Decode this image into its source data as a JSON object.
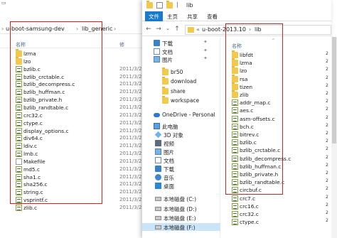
{
  "left_window": {
    "breadcrumb": [
      "u-boot-samsung-dev",
      "lib_generic"
    ],
    "column_name": "名称",
    "column_date": "修",
    "files": [
      {
        "name": "lzma",
        "kind": "folder",
        "date": ""
      },
      {
        "name": "lzo",
        "kind": "folder",
        "date": ""
      },
      {
        "name": "bzlib.c",
        "kind": "c",
        "date": "2011/3/2"
      },
      {
        "name": "bzlib_crctable.c",
        "kind": "c",
        "date": "2011/3/2"
      },
      {
        "name": "bzlib_decompress.c",
        "kind": "c",
        "date": "2011/3/2"
      },
      {
        "name": "bzlib_huffman.c",
        "kind": "c",
        "date": "2011/3/2"
      },
      {
        "name": "bzlib_private.h",
        "kind": "c",
        "date": "2011/3/2"
      },
      {
        "name": "bzlib_randtable.c",
        "kind": "c",
        "date": "2011/3/2"
      },
      {
        "name": "crc32.c",
        "kind": "c",
        "date": "2011/3/2"
      },
      {
        "name": "ctype.c",
        "kind": "c",
        "date": "2011/3/2"
      },
      {
        "name": "display_options.c",
        "kind": "c",
        "date": "2011/3/2"
      },
      {
        "name": "div64.c",
        "kind": "c",
        "date": "2011/3/2"
      },
      {
        "name": "ldiv.c",
        "kind": "c",
        "date": "2011/3/2"
      },
      {
        "name": "lmb.c",
        "kind": "c",
        "date": "2011/3/2"
      },
      {
        "name": "Makefile",
        "kind": "file",
        "date": "2011/3/2"
      },
      {
        "name": "md5.c",
        "kind": "c",
        "date": "2011/3/2"
      },
      {
        "name": "sha1.c",
        "kind": "c",
        "date": "2011/3/2"
      },
      {
        "name": "sha256.c",
        "kind": "c",
        "date": "2011/3/2"
      },
      {
        "name": "string.c",
        "kind": "c",
        "date": "2011/3/2"
      },
      {
        "name": "vsprintf.c",
        "kind": "c",
        "date": "2011/3/2"
      },
      {
        "name": "zlib.c",
        "kind": "c",
        "date": "2011/3/2"
      }
    ]
  },
  "right_window": {
    "title": "lib",
    "ribbon_tabs": [
      "文件",
      "主页",
      "共享",
      "查看"
    ],
    "address": [
      "u-boot-2013.10",
      "lib"
    ],
    "nav_items": [
      {
        "label": "下载",
        "icon": "download-icon",
        "pinned": true
      },
      {
        "label": "文档",
        "icon": "document-icon",
        "pinned": true
      },
      {
        "label": "图片",
        "icon": "picture-icon",
        "pinned": true
      },
      {
        "label": "br50",
        "icon": "folder-icon",
        "pinned": false
      },
      {
        "label": "download",
        "icon": "folder-icon",
        "pinned": false
      },
      {
        "label": "share",
        "icon": "folder-icon",
        "pinned": false
      },
      {
        "label": "workspace",
        "icon": "folder-icon",
        "pinned": false
      },
      {
        "label": "OneDrive - Personal",
        "icon": "onedrive-icon",
        "pinned": false
      },
      {
        "label": "此电脑",
        "icon": "pc-icon",
        "pinned": false
      },
      {
        "label": "3D 对象",
        "icon": "3d-objects-icon",
        "pinned": false
      },
      {
        "label": "视频",
        "icon": "video-icon",
        "pinned": false
      },
      {
        "label": "图片",
        "icon": "picture-icon",
        "pinned": false
      },
      {
        "label": "文档",
        "icon": "document-icon",
        "pinned": false
      },
      {
        "label": "下载",
        "icon": "download-icon",
        "pinned": false
      },
      {
        "label": "音乐",
        "icon": "music-icon",
        "pinned": false
      },
      {
        "label": "桌面",
        "icon": "desktop-icon",
        "pinned": false
      },
      {
        "label": "本地磁盘 (C:)",
        "icon": "drive-icon",
        "pinned": false
      },
      {
        "label": "本地磁盘 (D:)",
        "icon": "drive-icon",
        "pinned": false
      },
      {
        "label": "本地磁盘 (E:)",
        "icon": "drive-icon",
        "pinned": false
      },
      {
        "label": "本地磁盘 (F:)",
        "icon": "drive-icon",
        "pinned": false
      }
    ],
    "column_name": "名称",
    "files": [
      {
        "name": "libfdt",
        "kind": "folder"
      },
      {
        "name": "lzma",
        "kind": "folder"
      },
      {
        "name": "lzo",
        "kind": "folder"
      },
      {
        "name": "rsa",
        "kind": "folder"
      },
      {
        "name": "tizen",
        "kind": "folder"
      },
      {
        "name": "zlib",
        "kind": "folder"
      },
      {
        "name": "addr_map.c",
        "kind": "c"
      },
      {
        "name": "aes.c",
        "kind": "c"
      },
      {
        "name": "asm-offsets.c",
        "kind": "c"
      },
      {
        "name": "bch.c",
        "kind": "c"
      },
      {
        "name": "bitrev.c",
        "kind": "c"
      },
      {
        "name": "bzlib.c",
        "kind": "c"
      },
      {
        "name": "bzlib_crctable.c",
        "kind": "c"
      },
      {
        "name": "bzlib_decompress.c",
        "kind": "c"
      },
      {
        "name": "bzlib_huffman.c",
        "kind": "c"
      },
      {
        "name": "bzlib_private.h",
        "kind": "c"
      },
      {
        "name": "bzlib_randtable.c",
        "kind": "c"
      },
      {
        "name": "circbuf.c",
        "kind": "c"
      },
      {
        "name": "crc7.c",
        "kind": "c"
      },
      {
        "name": "crc16.c",
        "kind": "c"
      },
      {
        "name": "crc32.c",
        "kind": "c"
      },
      {
        "name": "ctype.c",
        "kind": "c"
      }
    ],
    "side_digits": [
      "2",
      "2",
      "2",
      "2",
      "2",
      "2",
      "2",
      "2",
      "2",
      "2",
      "2",
      "2",
      "2",
      "2",
      "2",
      "2",
      "2",
      "2",
      "2",
      "2",
      "2",
      "2"
    ]
  },
  "colors": {
    "highlight_box": "#d92020",
    "file_tab": "#1979ca",
    "selection": "#cce4f7"
  }
}
